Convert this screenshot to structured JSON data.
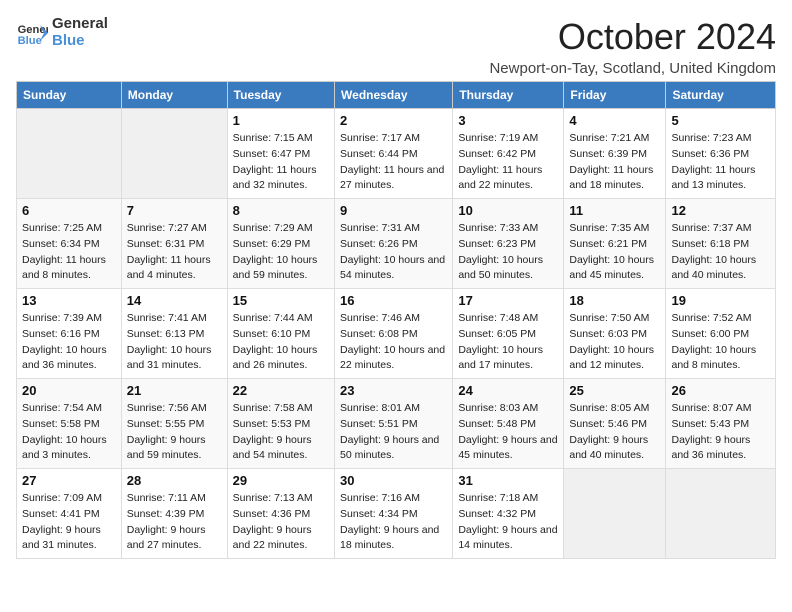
{
  "header": {
    "logo_line1": "General",
    "logo_line2": "Blue",
    "month_title": "October 2024",
    "location": "Newport-on-Tay, Scotland, United Kingdom"
  },
  "days_of_week": [
    "Sunday",
    "Monday",
    "Tuesday",
    "Wednesday",
    "Thursday",
    "Friday",
    "Saturday"
  ],
  "weeks": [
    [
      {
        "day": "",
        "sunrise": "",
        "sunset": "",
        "daylight": ""
      },
      {
        "day": "",
        "sunrise": "",
        "sunset": "",
        "daylight": ""
      },
      {
        "day": "1",
        "sunrise": "Sunrise: 7:15 AM",
        "sunset": "Sunset: 6:47 PM",
        "daylight": "Daylight: 11 hours and 32 minutes."
      },
      {
        "day": "2",
        "sunrise": "Sunrise: 7:17 AM",
        "sunset": "Sunset: 6:44 PM",
        "daylight": "Daylight: 11 hours and 27 minutes."
      },
      {
        "day": "3",
        "sunrise": "Sunrise: 7:19 AM",
        "sunset": "Sunset: 6:42 PM",
        "daylight": "Daylight: 11 hours and 22 minutes."
      },
      {
        "day": "4",
        "sunrise": "Sunrise: 7:21 AM",
        "sunset": "Sunset: 6:39 PM",
        "daylight": "Daylight: 11 hours and 18 minutes."
      },
      {
        "day": "5",
        "sunrise": "Sunrise: 7:23 AM",
        "sunset": "Sunset: 6:36 PM",
        "daylight": "Daylight: 11 hours and 13 minutes."
      }
    ],
    [
      {
        "day": "6",
        "sunrise": "Sunrise: 7:25 AM",
        "sunset": "Sunset: 6:34 PM",
        "daylight": "Daylight: 11 hours and 8 minutes."
      },
      {
        "day": "7",
        "sunrise": "Sunrise: 7:27 AM",
        "sunset": "Sunset: 6:31 PM",
        "daylight": "Daylight: 11 hours and 4 minutes."
      },
      {
        "day": "8",
        "sunrise": "Sunrise: 7:29 AM",
        "sunset": "Sunset: 6:29 PM",
        "daylight": "Daylight: 10 hours and 59 minutes."
      },
      {
        "day": "9",
        "sunrise": "Sunrise: 7:31 AM",
        "sunset": "Sunset: 6:26 PM",
        "daylight": "Daylight: 10 hours and 54 minutes."
      },
      {
        "day": "10",
        "sunrise": "Sunrise: 7:33 AM",
        "sunset": "Sunset: 6:23 PM",
        "daylight": "Daylight: 10 hours and 50 minutes."
      },
      {
        "day": "11",
        "sunrise": "Sunrise: 7:35 AM",
        "sunset": "Sunset: 6:21 PM",
        "daylight": "Daylight: 10 hours and 45 minutes."
      },
      {
        "day": "12",
        "sunrise": "Sunrise: 7:37 AM",
        "sunset": "Sunset: 6:18 PM",
        "daylight": "Daylight: 10 hours and 40 minutes."
      }
    ],
    [
      {
        "day": "13",
        "sunrise": "Sunrise: 7:39 AM",
        "sunset": "Sunset: 6:16 PM",
        "daylight": "Daylight: 10 hours and 36 minutes."
      },
      {
        "day": "14",
        "sunrise": "Sunrise: 7:41 AM",
        "sunset": "Sunset: 6:13 PM",
        "daylight": "Daylight: 10 hours and 31 minutes."
      },
      {
        "day": "15",
        "sunrise": "Sunrise: 7:44 AM",
        "sunset": "Sunset: 6:10 PM",
        "daylight": "Daylight: 10 hours and 26 minutes."
      },
      {
        "day": "16",
        "sunrise": "Sunrise: 7:46 AM",
        "sunset": "Sunset: 6:08 PM",
        "daylight": "Daylight: 10 hours and 22 minutes."
      },
      {
        "day": "17",
        "sunrise": "Sunrise: 7:48 AM",
        "sunset": "Sunset: 6:05 PM",
        "daylight": "Daylight: 10 hours and 17 minutes."
      },
      {
        "day": "18",
        "sunrise": "Sunrise: 7:50 AM",
        "sunset": "Sunset: 6:03 PM",
        "daylight": "Daylight: 10 hours and 12 minutes."
      },
      {
        "day": "19",
        "sunrise": "Sunrise: 7:52 AM",
        "sunset": "Sunset: 6:00 PM",
        "daylight": "Daylight: 10 hours and 8 minutes."
      }
    ],
    [
      {
        "day": "20",
        "sunrise": "Sunrise: 7:54 AM",
        "sunset": "Sunset: 5:58 PM",
        "daylight": "Daylight: 10 hours and 3 minutes."
      },
      {
        "day": "21",
        "sunrise": "Sunrise: 7:56 AM",
        "sunset": "Sunset: 5:55 PM",
        "daylight": "Daylight: 9 hours and 59 minutes."
      },
      {
        "day": "22",
        "sunrise": "Sunrise: 7:58 AM",
        "sunset": "Sunset: 5:53 PM",
        "daylight": "Daylight: 9 hours and 54 minutes."
      },
      {
        "day": "23",
        "sunrise": "Sunrise: 8:01 AM",
        "sunset": "Sunset: 5:51 PM",
        "daylight": "Daylight: 9 hours and 50 minutes."
      },
      {
        "day": "24",
        "sunrise": "Sunrise: 8:03 AM",
        "sunset": "Sunset: 5:48 PM",
        "daylight": "Daylight: 9 hours and 45 minutes."
      },
      {
        "day": "25",
        "sunrise": "Sunrise: 8:05 AM",
        "sunset": "Sunset: 5:46 PM",
        "daylight": "Daylight: 9 hours and 40 minutes."
      },
      {
        "day": "26",
        "sunrise": "Sunrise: 8:07 AM",
        "sunset": "Sunset: 5:43 PM",
        "daylight": "Daylight: 9 hours and 36 minutes."
      }
    ],
    [
      {
        "day": "27",
        "sunrise": "Sunrise: 7:09 AM",
        "sunset": "Sunset: 4:41 PM",
        "daylight": "Daylight: 9 hours and 31 minutes."
      },
      {
        "day": "28",
        "sunrise": "Sunrise: 7:11 AM",
        "sunset": "Sunset: 4:39 PM",
        "daylight": "Daylight: 9 hours and 27 minutes."
      },
      {
        "day": "29",
        "sunrise": "Sunrise: 7:13 AM",
        "sunset": "Sunset: 4:36 PM",
        "daylight": "Daylight: 9 hours and 22 minutes."
      },
      {
        "day": "30",
        "sunrise": "Sunrise: 7:16 AM",
        "sunset": "Sunset: 4:34 PM",
        "daylight": "Daylight: 9 hours and 18 minutes."
      },
      {
        "day": "31",
        "sunrise": "Sunrise: 7:18 AM",
        "sunset": "Sunset: 4:32 PM",
        "daylight": "Daylight: 9 hours and 14 minutes."
      },
      {
        "day": "",
        "sunrise": "",
        "sunset": "",
        "daylight": ""
      },
      {
        "day": "",
        "sunrise": "",
        "sunset": "",
        "daylight": ""
      }
    ]
  ]
}
